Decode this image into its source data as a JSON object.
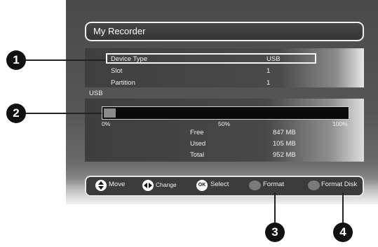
{
  "title": "My Recorder",
  "device": {
    "rows": [
      {
        "label": "Device  Type",
        "value": "USB"
      },
      {
        "label": "Slot",
        "value": "1"
      },
      {
        "label": "Partition",
        "value": "1"
      }
    ]
  },
  "usb_label": "USB",
  "usage": {
    "used_fraction": 0.05,
    "tick_start": "0%",
    "tick_mid": "50%",
    "tick_end": "100%"
  },
  "stats": [
    {
      "label": "Free",
      "value": "847 MB"
    },
    {
      "label": "Used",
      "value": "105 MB"
    },
    {
      "label": "Total",
      "value": "952 MB"
    }
  ],
  "hints": {
    "move": "Move",
    "change": "Change",
    "ok_icon": "OK",
    "select": "Select",
    "format": "Format",
    "format_disk": "Format Disk"
  },
  "callouts": {
    "c1": "1",
    "c2": "2",
    "c3": "3",
    "c4": "4"
  },
  "icons": {
    "move": "up-down-arrow-icon",
    "change": "left-right-arrow-icon",
    "ok": "ok-button-icon"
  }
}
